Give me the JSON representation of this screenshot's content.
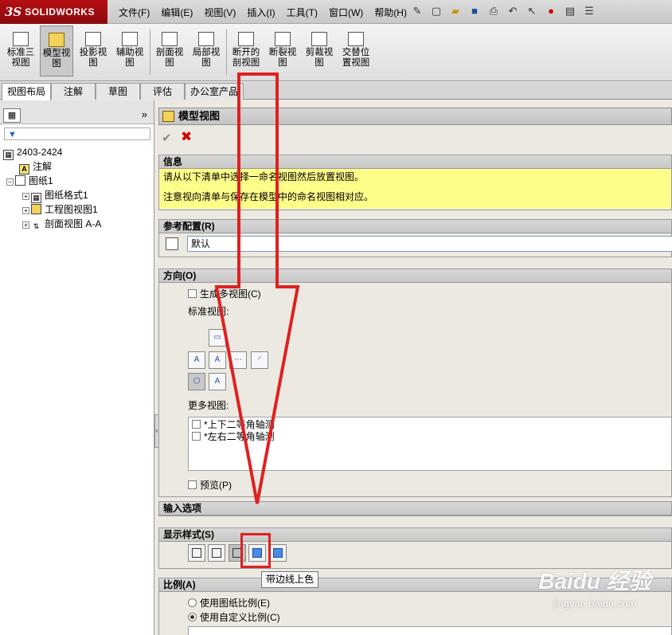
{
  "app": {
    "logo_mark": "3S",
    "logo_name": "SOLIDWORKS"
  },
  "menu": [
    "文件(F)",
    "编辑(E)",
    "视图(V)",
    "插入(I)",
    "工具(T)",
    "窗口(W)",
    "帮助(H)"
  ],
  "ribbon": [
    {
      "label": "标准三\n视图"
    },
    {
      "label": "模型视\n图"
    },
    {
      "label": "投影视\n图"
    },
    {
      "label": "辅助视\n图"
    },
    {
      "label": "剖面视\n图"
    },
    {
      "label": "局部视\n图"
    },
    {
      "label": "断开的\n剖视图"
    },
    {
      "label": "断裂视\n图"
    },
    {
      "label": "剪裁视\n图"
    },
    {
      "label": "交替位\n置视图"
    }
  ],
  "tabs": [
    "视图布局",
    "注解",
    "草图",
    "评估",
    "办公室产品"
  ],
  "tree": {
    "root": "2403-2424",
    "annotation": "注解",
    "sheet": "图纸1",
    "sheet_format": "图纸格式1",
    "drawing_view": "工程图视图1",
    "section_view": "剖面视图 A-A"
  },
  "pm": {
    "title": "模型视图",
    "info": {
      "header": "信息",
      "line1": "请从以下清单中选择一命名视图然后放置视图。",
      "line2": "注意视向清单与保存在模型中的命名视图相对应。"
    },
    "ref_config": {
      "header": "参考配置(R)",
      "value": "默认"
    },
    "orientation": {
      "header": "方向(O)",
      "create_multi": "生成多视图(C)",
      "standard_views": "标准视图:",
      "more_views": "更多视图:",
      "more_items": [
        "*上下二等角轴测",
        "*左右二等角轴测"
      ],
      "preview": "预览(P)"
    },
    "import_options": {
      "header": "输入选项"
    },
    "display_style": {
      "header": "显示样式(S)",
      "tooltip": "带边线上色"
    },
    "scale": {
      "header": "比例(A)",
      "use_sheet": "使用图纸比例(E)",
      "use_custom": "使用自定义比例(C)"
    }
  },
  "watermark": {
    "logo": "Baidu 经验",
    "url": "jingyan.baidu.com"
  },
  "colors": {
    "accent_red": "#e02020",
    "info_yellow": "#fdfd8a"
  }
}
